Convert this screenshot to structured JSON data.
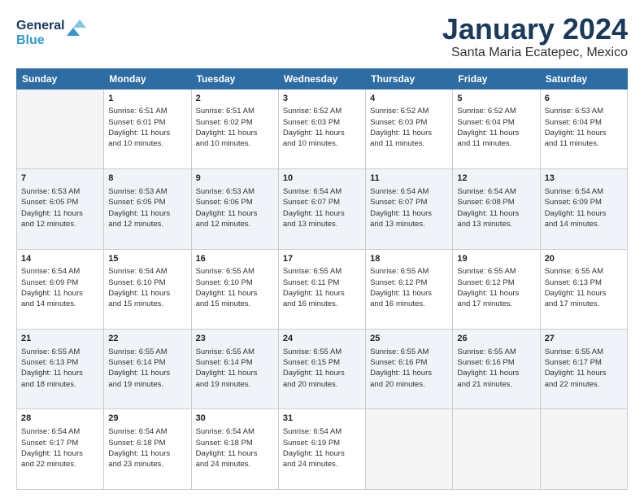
{
  "logo": {
    "line1": "General",
    "line2": "Blue"
  },
  "title": "January 2024",
  "location": "Santa Maria Ecatepec, Mexico",
  "headers": [
    "Sunday",
    "Monday",
    "Tuesday",
    "Wednesday",
    "Thursday",
    "Friday",
    "Saturday"
  ],
  "weeks": [
    [
      {
        "day": "",
        "info": ""
      },
      {
        "day": "1",
        "info": "Sunrise: 6:51 AM\nSunset: 6:01 PM\nDaylight: 11 hours\nand 10 minutes."
      },
      {
        "day": "2",
        "info": "Sunrise: 6:51 AM\nSunset: 6:02 PM\nDaylight: 11 hours\nand 10 minutes."
      },
      {
        "day": "3",
        "info": "Sunrise: 6:52 AM\nSunset: 6:03 PM\nDaylight: 11 hours\nand 10 minutes."
      },
      {
        "day": "4",
        "info": "Sunrise: 6:52 AM\nSunset: 6:03 PM\nDaylight: 11 hours\nand 11 minutes."
      },
      {
        "day": "5",
        "info": "Sunrise: 6:52 AM\nSunset: 6:04 PM\nDaylight: 11 hours\nand 11 minutes."
      },
      {
        "day": "6",
        "info": "Sunrise: 6:53 AM\nSunset: 6:04 PM\nDaylight: 11 hours\nand 11 minutes."
      }
    ],
    [
      {
        "day": "7",
        "info": "Sunrise: 6:53 AM\nSunset: 6:05 PM\nDaylight: 11 hours\nand 12 minutes."
      },
      {
        "day": "8",
        "info": "Sunrise: 6:53 AM\nSunset: 6:05 PM\nDaylight: 11 hours\nand 12 minutes."
      },
      {
        "day": "9",
        "info": "Sunrise: 6:53 AM\nSunset: 6:06 PM\nDaylight: 11 hours\nand 12 minutes."
      },
      {
        "day": "10",
        "info": "Sunrise: 6:54 AM\nSunset: 6:07 PM\nDaylight: 11 hours\nand 13 minutes."
      },
      {
        "day": "11",
        "info": "Sunrise: 6:54 AM\nSunset: 6:07 PM\nDaylight: 11 hours\nand 13 minutes."
      },
      {
        "day": "12",
        "info": "Sunrise: 6:54 AM\nSunset: 6:08 PM\nDaylight: 11 hours\nand 13 minutes."
      },
      {
        "day": "13",
        "info": "Sunrise: 6:54 AM\nSunset: 6:09 PM\nDaylight: 11 hours\nand 14 minutes."
      }
    ],
    [
      {
        "day": "14",
        "info": "Sunrise: 6:54 AM\nSunset: 6:09 PM\nDaylight: 11 hours\nand 14 minutes."
      },
      {
        "day": "15",
        "info": "Sunrise: 6:54 AM\nSunset: 6:10 PM\nDaylight: 11 hours\nand 15 minutes."
      },
      {
        "day": "16",
        "info": "Sunrise: 6:55 AM\nSunset: 6:10 PM\nDaylight: 11 hours\nand 15 minutes."
      },
      {
        "day": "17",
        "info": "Sunrise: 6:55 AM\nSunset: 6:11 PM\nDaylight: 11 hours\nand 16 minutes."
      },
      {
        "day": "18",
        "info": "Sunrise: 6:55 AM\nSunset: 6:12 PM\nDaylight: 11 hours\nand 16 minutes."
      },
      {
        "day": "19",
        "info": "Sunrise: 6:55 AM\nSunset: 6:12 PM\nDaylight: 11 hours\nand 17 minutes."
      },
      {
        "day": "20",
        "info": "Sunrise: 6:55 AM\nSunset: 6:13 PM\nDaylight: 11 hours\nand 17 minutes."
      }
    ],
    [
      {
        "day": "21",
        "info": "Sunrise: 6:55 AM\nSunset: 6:13 PM\nDaylight: 11 hours\nand 18 minutes."
      },
      {
        "day": "22",
        "info": "Sunrise: 6:55 AM\nSunset: 6:14 PM\nDaylight: 11 hours\nand 19 minutes."
      },
      {
        "day": "23",
        "info": "Sunrise: 6:55 AM\nSunset: 6:14 PM\nDaylight: 11 hours\nand 19 minutes."
      },
      {
        "day": "24",
        "info": "Sunrise: 6:55 AM\nSunset: 6:15 PM\nDaylight: 11 hours\nand 20 minutes."
      },
      {
        "day": "25",
        "info": "Sunrise: 6:55 AM\nSunset: 6:16 PM\nDaylight: 11 hours\nand 20 minutes."
      },
      {
        "day": "26",
        "info": "Sunrise: 6:55 AM\nSunset: 6:16 PM\nDaylight: 11 hours\nand 21 minutes."
      },
      {
        "day": "27",
        "info": "Sunrise: 6:55 AM\nSunset: 6:17 PM\nDaylight: 11 hours\nand 22 minutes."
      }
    ],
    [
      {
        "day": "28",
        "info": "Sunrise: 6:54 AM\nSunset: 6:17 PM\nDaylight: 11 hours\nand 22 minutes."
      },
      {
        "day": "29",
        "info": "Sunrise: 6:54 AM\nSunset: 6:18 PM\nDaylight: 11 hours\nand 23 minutes."
      },
      {
        "day": "30",
        "info": "Sunrise: 6:54 AM\nSunset: 6:18 PM\nDaylight: 11 hours\nand 24 minutes."
      },
      {
        "day": "31",
        "info": "Sunrise: 6:54 AM\nSunset: 6:19 PM\nDaylight: 11 hours\nand 24 minutes."
      },
      {
        "day": "",
        "info": ""
      },
      {
        "day": "",
        "info": ""
      },
      {
        "day": "",
        "info": ""
      }
    ]
  ]
}
